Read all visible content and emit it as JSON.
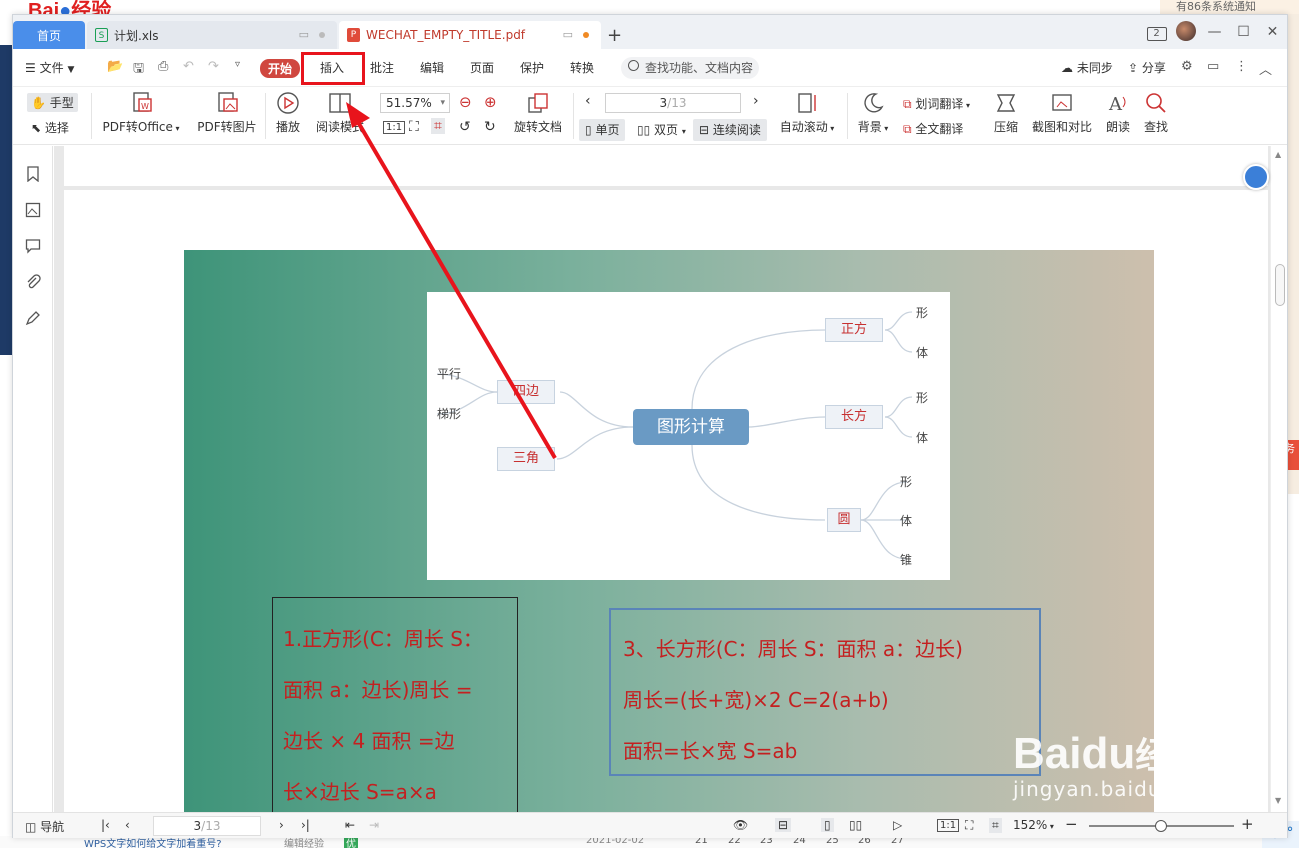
{
  "background": {
    "brand_text": "Bai",
    "brand_tail": "经验",
    "top_right_notice": "有86条系统通知",
    "right_badge": "务",
    "bottom_article": "WPS文字如何给文字加着重号?",
    "bottom_tag": "编辑经验",
    "bottom_badge": "优",
    "bottom_date": "2021-02-02",
    "bottom_numbers": [
      "21",
      "22",
      "23",
      "24",
      "25",
      "26",
      "27"
    ],
    "ime_label": "中"
  },
  "tabs": {
    "home": "首页",
    "xls": "计划.xls",
    "pdf": "WECHAT_EMPTY_TITLE.pdf",
    "new_tab": "+"
  },
  "window_controls": {
    "badge": "2",
    "minimize": "—",
    "maximize": "☐",
    "close": "✕"
  },
  "menu": {
    "file": "文件",
    "items": [
      "开始",
      "插入",
      "批注",
      "编辑",
      "页面",
      "保护",
      "转换"
    ],
    "search_placeholder": "查找功能、文档内容",
    "sync": "未同步",
    "share": "分享"
  },
  "toolbar": {
    "hand": "手型",
    "select": "选择",
    "pdf_to_office": "PDF转Office",
    "pdf_to_image": "PDF转图片",
    "play": "播放",
    "read_mode": "阅读模式",
    "zoom": "51.57%",
    "rotate": "旋转文档",
    "page_current": "3",
    "page_total": "/13",
    "single": "单页",
    "double": "双页",
    "continuous": "连续阅读",
    "auto_scroll": "自动滚动",
    "background": "背景",
    "word_translate": "划词翻译",
    "full_translate": "全文翻译",
    "compress": "压缩",
    "screenshot_compare": "截图和对比",
    "read_aloud": "朗读",
    "find": "查找"
  },
  "mindmap": {
    "center": "图形计算",
    "sibian": "四边",
    "sanjiao": "三角",
    "zhengfang": "正方",
    "changfang": "长方",
    "yuan": "圆",
    "pingxing": "平行",
    "tixing": "梯形",
    "leaves_zf": [
      "形",
      "体"
    ],
    "leaves_cf": [
      "形",
      "体"
    ],
    "leaves_y": [
      "形",
      "体",
      "锥"
    ]
  },
  "box1_lines": [
    "1.正方形(C：周长  S：",
    "面积   a：边长)周长 =",
    "边长 × 4        面积 =边",
    "长×边长   S=a×a"
  ],
  "box2_lines": [
    "3、长方形(C：周长    S：面积      a：边长)",
    "周长=(长+宽)×2         C=2(a+b)",
    "面积=长×宽         S=ab"
  ],
  "statusbar": {
    "nav": "导航",
    "page_current": "3",
    "page_total": "/13",
    "zoom": "152%"
  },
  "watermark": {
    "brand": "Bai",
    "brand_tail": "du",
    "suffix": "经验",
    "url": "jingyan.baidu.com"
  }
}
